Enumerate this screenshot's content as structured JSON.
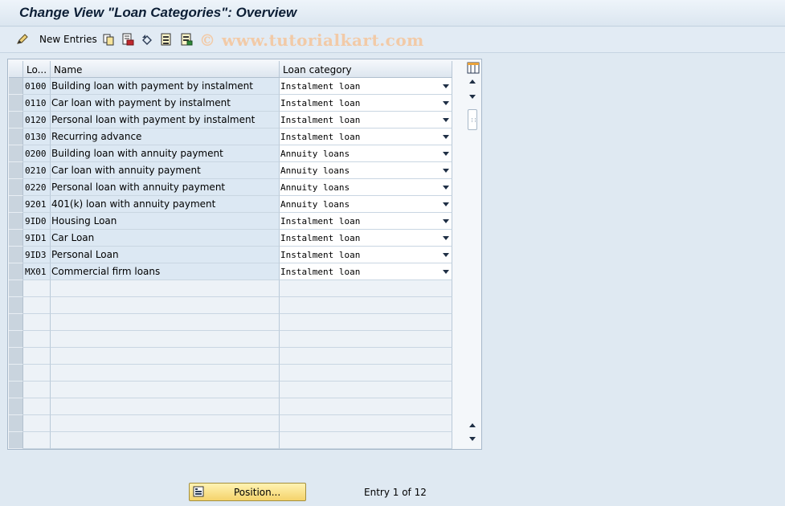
{
  "window": {
    "title": "Change View \"Loan Categories\": Overview"
  },
  "toolbar": {
    "new_entries_label": "New Entries",
    "watermark": "© www.tutorialkart.com",
    "icons": [
      "change-display-icon",
      "copy-icon",
      "delete-icon",
      "undo-icon",
      "select-all-icon",
      "deselect-all-icon"
    ]
  },
  "table": {
    "headers": [
      "Lo...",
      "Name",
      "Loan category"
    ],
    "rows": [
      {
        "key": "0100",
        "name": "Building loan with payment by instalment",
        "category": "Instalment loan"
      },
      {
        "key": "0110",
        "name": "Car loan with payment by instalment",
        "category": "Instalment loan"
      },
      {
        "key": "0120",
        "name": "Personal loan with payment by instalment",
        "category": "Instalment loan"
      },
      {
        "key": "0130",
        "name": "Recurring advance",
        "category": "Instalment loan"
      },
      {
        "key": "0200",
        "name": "Building loan with annuity payment",
        "category": "Annuity loans"
      },
      {
        "key": "0210",
        "name": "Car loan with annuity payment",
        "category": "Annuity loans"
      },
      {
        "key": "0220",
        "name": "Personal loan with annuity payment",
        "category": "Annuity loans"
      },
      {
        "key": "9201",
        "name": "401(k) loan with annuity payment",
        "category": "Annuity loans"
      },
      {
        "key": "9ID0",
        "name": "Housing Loan",
        "category": "Instalment loan"
      },
      {
        "key": "9ID1",
        "name": "Car Loan",
        "category": "Instalment loan"
      },
      {
        "key": "9ID3",
        "name": "Personal Loan",
        "category": "Instalment loan"
      },
      {
        "key": "MX01",
        "name": "Commercial firm loans",
        "category": "Instalment loan"
      }
    ],
    "empty_rows": 10
  },
  "footer": {
    "position_button_label": "Position...",
    "entry_text": "Entry 1 of 12"
  },
  "colors": {
    "background": "#dfe9f2",
    "title_text": "#0c1e35",
    "position_button": "#f5d36b",
    "input_cell": "#ffffff"
  }
}
